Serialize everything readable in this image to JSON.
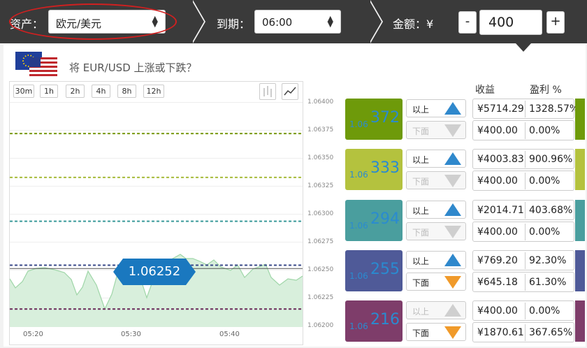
{
  "topbar": {
    "asset_label": "资产：",
    "asset_value": "欧元/美元",
    "expiry_label": "到期：",
    "expiry_value": "06:00",
    "amount_label": "金额：¥",
    "minus": "-",
    "amount_value": "400",
    "plus": "+"
  },
  "question": "将 EUR/USD 上涨或下跌？",
  "flag_icon": "eu-us-flag-icon",
  "chart": {
    "timeframes": [
      "30m",
      "1h",
      "2h",
      "4h",
      "8h",
      "12h"
    ],
    "y_ticks": [
      "1.06400",
      "1.06375",
      "1.06350",
      "1.06325",
      "1.06300",
      "1.06275",
      "1.06250",
      "1.06225",
      "1.06200"
    ],
    "x_ticks": [
      "05:20",
      "05:30",
      "05:40"
    ],
    "current_price": "1.06252"
  },
  "chart_data": {
    "type": "area",
    "y_range": [
      1.062,
      1.064
    ],
    "current": 1.06252,
    "strike_lines": [
      {
        "value": 1.06372,
        "color": "#7a9a10"
      },
      {
        "value": 1.06333,
        "color": "#a8bc3c"
      },
      {
        "value": 1.06294,
        "color": "#3a9a9a"
      },
      {
        "value": 1.06255,
        "color": "#3a4a8a"
      },
      {
        "value": 1.06216,
        "color": "#6a2a5a"
      }
    ],
    "series_color": "#9fd6a8"
  },
  "columns": {
    "payout": "收益",
    "profit": "盈利 %"
  },
  "rows": [
    {
      "prefix": "1.06",
      "strike": "372",
      "color": "#6e9a0a",
      "above": "以上",
      "below": "下面",
      "above_active": true,
      "below_active": false,
      "above_pay": "¥5714.29",
      "above_pct": "1328.57%",
      "below_pay": "¥400.00",
      "below_pct": "0.00%"
    },
    {
      "prefix": "1.06",
      "strike": "333",
      "color": "#b4c23e",
      "above": "以上",
      "below": "下面",
      "above_active": true,
      "below_active": false,
      "above_pay": "¥4003.83",
      "above_pct": "900.96%",
      "below_pay": "¥400.00",
      "below_pct": "0.00%"
    },
    {
      "prefix": "1.06",
      "strike": "294",
      "color": "#4a9e9e",
      "above": "以上",
      "below": "下面",
      "above_active": true,
      "below_active": false,
      "above_pay": "¥2014.71",
      "above_pct": "403.68%",
      "below_pay": "¥400.00",
      "below_pct": "0.00%"
    },
    {
      "prefix": "1.06",
      "strike": "255",
      "color": "#4f5a98",
      "above": "以上",
      "below": "下面",
      "above_active": true,
      "below_active": true,
      "above_pay": "¥769.20",
      "above_pct": "92.30%",
      "below_pay": "¥645.18",
      "below_pct": "61.30%"
    },
    {
      "prefix": "1.06",
      "strike": "216",
      "color": "#7e3d6a",
      "above": "以上",
      "below": "下面",
      "above_active": false,
      "below_active": true,
      "above_pay": "¥400.00",
      "above_pct": "0.00%",
      "below_pay": "¥1870.61",
      "below_pct": "367.65%"
    }
  ]
}
